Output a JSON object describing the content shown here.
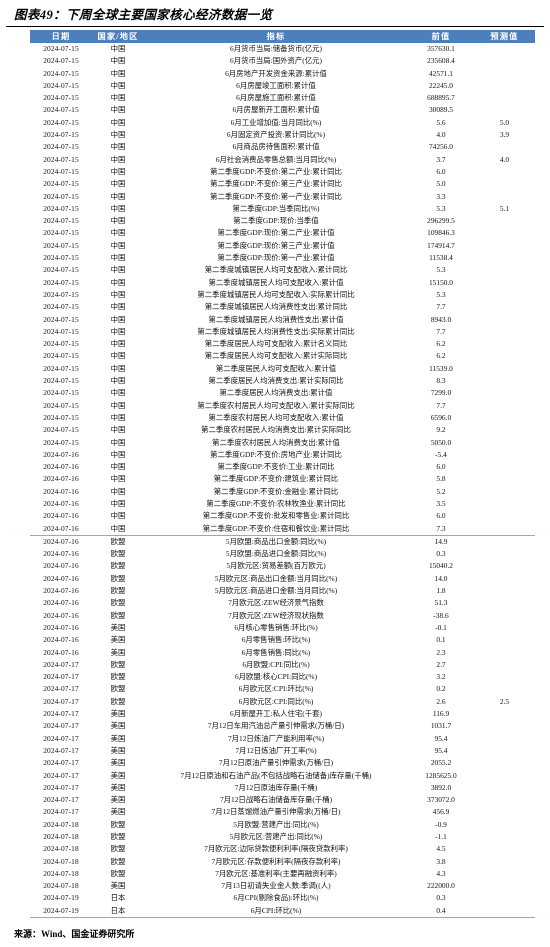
{
  "figure": {
    "title": "图表49：下周全球主要国家核心经济数据一览",
    "source": "来源：Wind、国金证券研究所"
  },
  "table": {
    "columns": [
      "日期",
      "国家/地区",
      "指标",
      "前值",
      "预测值"
    ],
    "header_bg": "#4E7FBD",
    "header_fg": "#FFFFFF",
    "divider_color": "#8FA9C7",
    "rows": [
      {
        "date": "2024-07-15",
        "region": "中国",
        "indicator": "6月货币当局:储备货币(亿元)",
        "prev": "357630.1",
        "forecast": ""
      },
      {
        "date": "2024-07-15",
        "region": "中国",
        "indicator": "6月货币当局:国外资产(亿元)",
        "prev": "235608.4",
        "forecast": ""
      },
      {
        "date": "2024-07-15",
        "region": "中国",
        "indicator": "6月房地产开发资金来源:累计值",
        "prev": "42571.1",
        "forecast": ""
      },
      {
        "date": "2024-07-15",
        "region": "中国",
        "indicator": "6月房屋竣工面积:累计值",
        "prev": "22245.0",
        "forecast": ""
      },
      {
        "date": "2024-07-15",
        "region": "中国",
        "indicator": "6月房屋施工面积:累计值",
        "prev": "688895.7",
        "forecast": ""
      },
      {
        "date": "2024-07-15",
        "region": "中国",
        "indicator": "6月房屋新开工面积:累计值",
        "prev": "30089.5",
        "forecast": ""
      },
      {
        "date": "2024-07-15",
        "region": "中国",
        "indicator": "6月工业增加值:当月同比(%)",
        "prev": "5.6",
        "forecast": "5.0"
      },
      {
        "date": "2024-07-15",
        "region": "中国",
        "indicator": "6月固定资产投资:累计同比(%)",
        "prev": "4.0",
        "forecast": "3.9"
      },
      {
        "date": "2024-07-15",
        "region": "中国",
        "indicator": "6月商品房待售面积:累计值",
        "prev": "74256.0",
        "forecast": ""
      },
      {
        "date": "2024-07-15",
        "region": "中国",
        "indicator": "6月社会消费品零售总额:当月同比(%)",
        "prev": "3.7",
        "forecast": "4.0"
      },
      {
        "date": "2024-07-15",
        "region": "中国",
        "indicator": "第二季度GDP:不变价:第二产业:累计同比",
        "prev": "6.0",
        "forecast": ""
      },
      {
        "date": "2024-07-15",
        "region": "中国",
        "indicator": "第二季度GDP:不变价:第三产业:累计同比",
        "prev": "5.0",
        "forecast": ""
      },
      {
        "date": "2024-07-15",
        "region": "中国",
        "indicator": "第二季度GDP:不变价:第一产业:累计同比",
        "prev": "3.3",
        "forecast": ""
      },
      {
        "date": "2024-07-15",
        "region": "中国",
        "indicator": "第二季度GDP:当季同比(%)",
        "prev": "5.3",
        "forecast": "5.1"
      },
      {
        "date": "2024-07-15",
        "region": "中国",
        "indicator": "第二季度GDP:现价:当季值",
        "prev": "296299.5",
        "forecast": ""
      },
      {
        "date": "2024-07-15",
        "region": "中国",
        "indicator": "第二季度GDP:现价:第二产业:累计值",
        "prev": "109846.3",
        "forecast": ""
      },
      {
        "date": "2024-07-15",
        "region": "中国",
        "indicator": "第二季度GDP:现价:第三产业:累计值",
        "prev": "174914.7",
        "forecast": ""
      },
      {
        "date": "2024-07-15",
        "region": "中国",
        "indicator": "第二季度GDP:现价:第一产业:累计值",
        "prev": "11538.4",
        "forecast": ""
      },
      {
        "date": "2024-07-15",
        "region": "中国",
        "indicator": "第二季度城镇居民人均可支配收入:累计同比",
        "prev": "5.3",
        "forecast": ""
      },
      {
        "date": "2024-07-15",
        "region": "中国",
        "indicator": "第二季度城镇居民人均可支配收入:累计值",
        "prev": "15150.0",
        "forecast": ""
      },
      {
        "date": "2024-07-15",
        "region": "中国",
        "indicator": "第二季度城镇居民人均可支配收入:实际累计同比",
        "prev": "5.3",
        "forecast": ""
      },
      {
        "date": "2024-07-15",
        "region": "中国",
        "indicator": "第二季度城镇居民人均消费性支出:累计同比",
        "prev": "7.7",
        "forecast": ""
      },
      {
        "date": "2024-07-15",
        "region": "中国",
        "indicator": "第二季度城镇居民人均消费性支出:累计值",
        "prev": "8943.0",
        "forecast": ""
      },
      {
        "date": "2024-07-15",
        "region": "中国",
        "indicator": "第二季度城镇居民人均消费性支出:实际累计同比",
        "prev": "7.7",
        "forecast": ""
      },
      {
        "date": "2024-07-15",
        "region": "中国",
        "indicator": "第二季度居民人均可支配收入:累计名义同比",
        "prev": "6.2",
        "forecast": ""
      },
      {
        "date": "2024-07-15",
        "region": "中国",
        "indicator": "第二季度居民人均可支配收入:累计实际同比",
        "prev": "6.2",
        "forecast": ""
      },
      {
        "date": "2024-07-15",
        "region": "中国",
        "indicator": "第二季度居民人均可支配收入:累计值",
        "prev": "11539.0",
        "forecast": ""
      },
      {
        "date": "2024-07-15",
        "region": "中国",
        "indicator": "第二季度居民人均消费支出:累计实际同比",
        "prev": "8.3",
        "forecast": ""
      },
      {
        "date": "2024-07-15",
        "region": "中国",
        "indicator": "第二季度居民人均消费支出:累计值",
        "prev": "7299.0",
        "forecast": ""
      },
      {
        "date": "2024-07-15",
        "region": "中国",
        "indicator": "第二季度农村居民人均可支配收入:累计实际同比",
        "prev": "7.7",
        "forecast": ""
      },
      {
        "date": "2024-07-15",
        "region": "中国",
        "indicator": "第二季度农村居民人均可支配收入:累计值",
        "prev": "6596.0",
        "forecast": ""
      },
      {
        "date": "2024-07-15",
        "region": "中国",
        "indicator": "第二季度农村居民人均消费支出:累计实际同比",
        "prev": "9.2",
        "forecast": ""
      },
      {
        "date": "2024-07-15",
        "region": "中国",
        "indicator": "第二季度农村居民人均消费支出:累计值",
        "prev": "5050.0",
        "forecast": ""
      },
      {
        "date": "2024-07-16",
        "region": "中国",
        "indicator": "第二季度GDP:不变价:房地产业:累计同比",
        "prev": "-5.4",
        "forecast": ""
      },
      {
        "date": "2024-07-16",
        "region": "中国",
        "indicator": "第二季度GDP:不变价:工业:累计同比",
        "prev": "6.0",
        "forecast": ""
      },
      {
        "date": "2024-07-16",
        "region": "中国",
        "indicator": "第二季度GDP:不变价:建筑业:累计同比",
        "prev": "5.8",
        "forecast": ""
      },
      {
        "date": "2024-07-16",
        "region": "中国",
        "indicator": "第二季度GDP:不变价:金融业:累计同比",
        "prev": "5.2",
        "forecast": ""
      },
      {
        "date": "2024-07-16",
        "region": "中国",
        "indicator": "第二季度GDP:不变价:农林牧渔业:累计同比",
        "prev": "3.5",
        "forecast": ""
      },
      {
        "date": "2024-07-16",
        "region": "中国",
        "indicator": "第二季度GDP:不变价:批发和零售业:累计同比",
        "prev": "6.0",
        "forecast": ""
      },
      {
        "date": "2024-07-16",
        "region": "中国",
        "indicator": "第二季度GDP:不变价:住宿和餐饮业:累计同比",
        "prev": "7.3",
        "forecast": "",
        "section_end": true
      },
      {
        "date": "2024-07-16",
        "region": "欧盟",
        "indicator": "5月欧盟:商品出口金额:同比(%)",
        "prev": "14.9",
        "forecast": ""
      },
      {
        "date": "2024-07-16",
        "region": "欧盟",
        "indicator": "5月欧盟:商品进口金额:同比(%)",
        "prev": "0.3",
        "forecast": ""
      },
      {
        "date": "2024-07-16",
        "region": "欧盟",
        "indicator": "5月欧元区:贸易差额(百万欧元)",
        "prev": "15040.2",
        "forecast": ""
      },
      {
        "date": "2024-07-16",
        "region": "欧盟",
        "indicator": "5月欧元区:商品出口金额:当月同比(%)",
        "prev": "14.0",
        "forecast": ""
      },
      {
        "date": "2024-07-16",
        "region": "欧盟",
        "indicator": "5月欧元区:商品进口金额:当月同比(%)",
        "prev": "1.8",
        "forecast": ""
      },
      {
        "date": "2024-07-16",
        "region": "欧盟",
        "indicator": "7月欧元区:ZEW经济景气指数",
        "prev": "51.3",
        "forecast": ""
      },
      {
        "date": "2024-07-16",
        "region": "欧盟",
        "indicator": "7月欧元区:ZEW经济现状指数",
        "prev": "-38.6",
        "forecast": ""
      },
      {
        "date": "2024-07-16",
        "region": "美国",
        "indicator": "6月核心零售销售:环比(%)",
        "prev": "-0.1",
        "forecast": ""
      },
      {
        "date": "2024-07-16",
        "region": "美国",
        "indicator": "6月零售销售:环比(%)",
        "prev": "0.1",
        "forecast": ""
      },
      {
        "date": "2024-07-16",
        "region": "美国",
        "indicator": "6月零售销售:同比(%)",
        "prev": "2.3",
        "forecast": ""
      },
      {
        "date": "2024-07-17",
        "region": "欧盟",
        "indicator": "6月欧盟:CPI:同比(%)",
        "prev": "2.7",
        "forecast": ""
      },
      {
        "date": "2024-07-17",
        "region": "欧盟",
        "indicator": "6月欧盟:核心CPI:同比(%)",
        "prev": "3.2",
        "forecast": ""
      },
      {
        "date": "2024-07-17",
        "region": "欧盟",
        "indicator": "6月欧元区:CPI:环比(%)",
        "prev": "0.2",
        "forecast": ""
      },
      {
        "date": "2024-07-17",
        "region": "欧盟",
        "indicator": "6月欧元区:CPI:同比(%)",
        "prev": "2.6",
        "forecast": "2.5"
      },
      {
        "date": "2024-07-17",
        "region": "美国",
        "indicator": "6月新屋开工:私人住宅(千套)",
        "prev": "116.9",
        "forecast": ""
      },
      {
        "date": "2024-07-17",
        "region": "美国",
        "indicator": "7月12日车用汽油总产量引伸需求(万桶/日)",
        "prev": "1031.7",
        "forecast": ""
      },
      {
        "date": "2024-07-17",
        "region": "美国",
        "indicator": "7月12日炼油厂产能利用率(%)",
        "prev": "95.4",
        "forecast": ""
      },
      {
        "date": "2024-07-17",
        "region": "美国",
        "indicator": "7月12日炼油厂开工率(%)",
        "prev": "95.4",
        "forecast": ""
      },
      {
        "date": "2024-07-17",
        "region": "美国",
        "indicator": "7月12日原油产量引伸需求(万桶/日)",
        "prev": "2055.2",
        "forecast": ""
      },
      {
        "date": "2024-07-17",
        "region": "美国",
        "indicator": "7月12日原油和石油产品(不包括战略石油储备)库存量(千桶)",
        "prev": "1285625.0",
        "forecast": ""
      },
      {
        "date": "2024-07-17",
        "region": "美国",
        "indicator": "7月12日原油库存量(千桶)",
        "prev": "3892.0",
        "forecast": ""
      },
      {
        "date": "2024-07-17",
        "region": "美国",
        "indicator": "7月12日战略石油储备库存量(千桶)",
        "prev": "373072.0",
        "forecast": ""
      },
      {
        "date": "2024-07-17",
        "region": "美国",
        "indicator": "7月12日蒸馏燃油产量引伸需求(万桶/日)",
        "prev": "456.9",
        "forecast": ""
      },
      {
        "date": "2024-07-18",
        "region": "欧盟",
        "indicator": "5月欧盟:营建产出:同比(%)",
        "prev": "-0.9",
        "forecast": ""
      },
      {
        "date": "2024-07-18",
        "region": "欧盟",
        "indicator": "5月欧元区:营建产出:同比(%)",
        "prev": "-1.1",
        "forecast": ""
      },
      {
        "date": "2024-07-18",
        "region": "欧盟",
        "indicator": "7月欧元区:边际贷款便利利率(隔夜贷款利率)",
        "prev": "4.5",
        "forecast": ""
      },
      {
        "date": "2024-07-18",
        "region": "欧盟",
        "indicator": "7月欧元区:存款便利利率(隔夜存款利率)",
        "prev": "3.8",
        "forecast": ""
      },
      {
        "date": "2024-07-18",
        "region": "欧盟",
        "indicator": "7月欧元区:基准利率(主要再融资利率)",
        "prev": "4.3",
        "forecast": ""
      },
      {
        "date": "2024-07-18",
        "region": "美国",
        "indicator": "7月13日初请失业金人数:季调((人)",
        "prev": "222000.0",
        "forecast": ""
      },
      {
        "date": "2024-07-19",
        "region": "日本",
        "indicator": "6月CPI(剔除食品):环比(%)",
        "prev": "0.3",
        "forecast": ""
      },
      {
        "date": "2024-07-19",
        "region": "日本",
        "indicator": "6月CPI:环比(%)",
        "prev": "0.4",
        "forecast": ""
      }
    ]
  }
}
